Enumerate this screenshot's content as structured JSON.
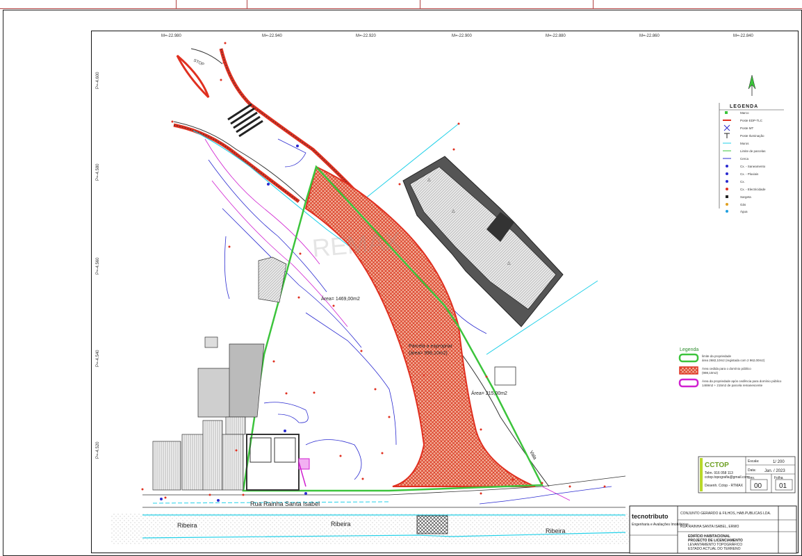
{
  "grid": {
    "x_labels": [
      "M=-22.980",
      "M=-22.940",
      "M=-22.920",
      "M=-22.900",
      "M=-22.880",
      "M=-22.860",
      "M=-22.840"
    ],
    "y_labels": [
      "P=-4.600",
      "P=-4.580",
      "P=-4.560",
      "P=-4.540",
      "P=-4.520"
    ]
  },
  "labels": {
    "stop": "STOP",
    "street": "Rua Rainha Santa Isabel",
    "river_1": "Ribeira",
    "river_2": "Ribeira",
    "river_3": "Ribeira",
    "vala": "Vala",
    "area_1": "Área= 1469,00m2",
    "area_2": "Área= 215,00m2",
    "area_3a": "Parcela a expropriar",
    "area_3b": "(área= 998,10m2)",
    "watermark": "REMAX"
  },
  "legend_top": {
    "title": "LEGENDA",
    "items": [
      "Marco",
      "Poste EDP-TLC",
      "Poste MT",
      "Poste Iluminação",
      "Muros",
      "Limite de parcelas",
      "Cerca",
      "Cx. - Saneamento",
      "Cx. - Pluviais",
      "Cx.",
      "Cx. - Electricidade",
      "Sargeta",
      "Gás",
      "Água"
    ]
  },
  "legend_bottom": {
    "title": "Legenda",
    "items": [
      {
        "line1": "limite da propriedade",
        "line2": "área 2682,10m2 (registada com 2 962,00m2)"
      },
      {
        "line1": "Área cedida para o domínio público",
        "line2": "(998,10m2)"
      },
      {
        "line1": "Área da propriedade após cedência para domínio público",
        "line2": "1469m2 + 215m2 de parcela remanescente"
      }
    ]
  },
  "stamp": {
    "company": "CCTOP",
    "contact": "Telm. 916 058 113",
    "email": "cctop.topografia@gmail.com",
    "surveyor": "Desenh. Cctop - RTMAX",
    "scale_label": "Escala:",
    "scale": "1/ 200",
    "date_label": "Data:",
    "date": "Jan. / 2023",
    "rev_label": "Rev.",
    "rev": "00",
    "sheet_label": "Folha",
    "sheet": "01"
  },
  "title_block": {
    "brand": "tecnotributo",
    "tagline": "Engenharia e Avaliações Imobiliárias",
    "client": "CONJUNTO GERARDO & FILHOS, HAB.PUBLICAS LDA.",
    "location": "RUA RAINHA SANTA ISABEL, ERMO",
    "title1": "EDIFÍCIO HABITACIONAL",
    "title2": "PROJECTO DE LICENCIAMENTO",
    "title3": "LEVANTAMENTO TOPOGRÁFICO",
    "title4": "ESTADO ACTUAL DO TERRENO"
  },
  "colors": {
    "boundary_green": "#3cc43c",
    "ceded_red": "#e03020",
    "contour_blue": "#2a2ad0",
    "contour_magenta": "#d020d0",
    "cyan": "#20d0e8",
    "building": "#444444"
  }
}
